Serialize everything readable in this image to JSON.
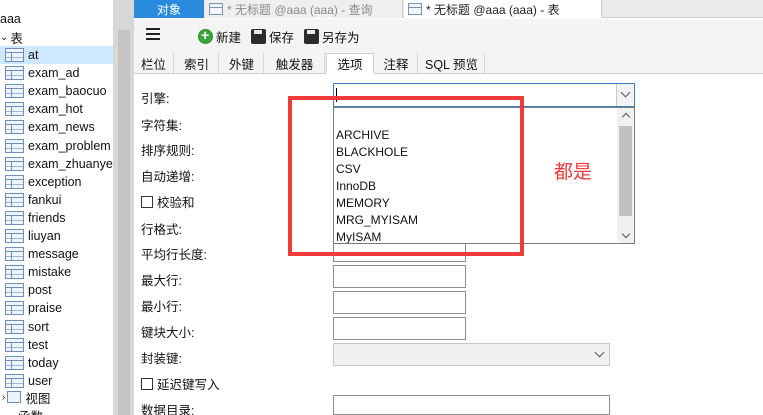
{
  "tree": {
    "db_label": "aaa",
    "tables_label": "表",
    "tables": [
      "at",
      "exam_ad",
      "exam_baocuo",
      "exam_hot",
      "exam_news",
      "exam_problem",
      "exam_zhuanye",
      "exception",
      "fankui",
      "friends",
      "liuyan",
      "message",
      "mistake",
      "post",
      "praise",
      "sort",
      "test",
      "today",
      "user"
    ],
    "views_label": "视图",
    "functions_label": "函数"
  },
  "tabs": {
    "objects": "对象",
    "query": "* 无标题 @aaa (aaa) - 查询",
    "table": "* 无标题 @aaa (aaa) - 表"
  },
  "toolbar": {
    "new_label": "新建",
    "save_label": "保存",
    "saveas_label": "另存为"
  },
  "subtabs": [
    "栏位",
    "索引",
    "外键",
    "触发器",
    "选项",
    "注释",
    "SQL 预览"
  ],
  "subtabs_active": "选项",
  "form": {
    "engine_label": "引擎:",
    "engine_value": "",
    "charset_label": "字符集:",
    "collation_label": "排序规则:",
    "auto_inc_label": "自动递增:",
    "checksum_label": "校验和",
    "row_format_label": "行格式:",
    "avg_row_len_label": "平均行长度:",
    "max_rows_label": "最大行:",
    "min_rows_label": "最小行:",
    "key_block_label": "键块大小:",
    "pack_keys_label": "封装键:",
    "delay_key_label": "延迟键写入",
    "data_dir_label": "数据目录:"
  },
  "engine_options": [
    "ARCHIVE",
    "BLACKHOLE",
    "CSV",
    "InnoDB",
    "MEMORY",
    "MRG_MYISAM",
    "MyISAM"
  ],
  "annotation": {
    "note": "都是",
    "color": "#ef3b3b"
  },
  "colors": {
    "accent": "#2a8bdc",
    "selected_row": "#cde8ff"
  },
  "icons": [
    "table-icon",
    "view-icon",
    "hamburger-icon",
    "new-icon",
    "save-icon",
    "saveas-icon"
  ]
}
